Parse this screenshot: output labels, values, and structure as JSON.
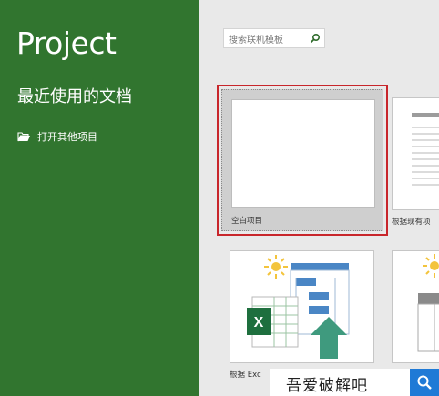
{
  "app": {
    "title": "Project"
  },
  "sidebar": {
    "recent_heading": "最近使用的文档",
    "open_other_label": "打开其他项目",
    "open_other_icon": "folder-open-icon"
  },
  "search": {
    "placeholder": "搜索联机模板",
    "icon": "search-icon"
  },
  "templates": [
    {
      "label": "空白项目",
      "selected": true
    },
    {
      "label": "根据现有项",
      "selected": false
    },
    {
      "label": "根据 Exc",
      "selected": false
    },
    {
      "label": "",
      "selected": false
    }
  ],
  "watermark": {
    "text": "吾爱破解吧",
    "icon": "search-icon"
  },
  "colors": {
    "sidebar_bg": "#31752f",
    "content_bg": "#e9e9e9",
    "selection_border": "#c8262b",
    "excel_green": "#1e6f3e",
    "arrow_green": "#3f9a7e",
    "diagram_blue": "#4a86c5",
    "sun_yellow": "#f3c43c",
    "watermark_blue": "#1f7ad6"
  }
}
